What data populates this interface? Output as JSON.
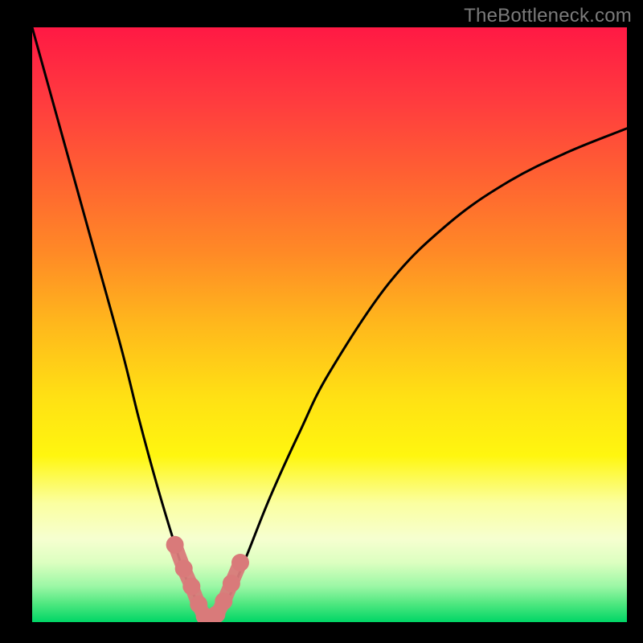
{
  "watermark": "TheBottleneck.com",
  "colors": {
    "background_black": "#000000",
    "text_gray": "#7b7b7b",
    "curve_black": "#000000",
    "accent_pink": "#d97a7a",
    "gradient_stops": [
      {
        "offset": 0.0,
        "color": "#ff1944"
      },
      {
        "offset": 0.12,
        "color": "#ff3a3f"
      },
      {
        "offset": 0.25,
        "color": "#ff6132"
      },
      {
        "offset": 0.38,
        "color": "#ff8a26"
      },
      {
        "offset": 0.5,
        "color": "#ffb81c"
      },
      {
        "offset": 0.62,
        "color": "#ffe014"
      },
      {
        "offset": 0.72,
        "color": "#fff60f"
      },
      {
        "offset": 0.8,
        "color": "#fbffa0"
      },
      {
        "offset": 0.86,
        "color": "#f6ffd0"
      },
      {
        "offset": 0.9,
        "color": "#dcffc0"
      },
      {
        "offset": 0.94,
        "color": "#9bf7a5"
      },
      {
        "offset": 0.97,
        "color": "#4de77f"
      },
      {
        "offset": 1.0,
        "color": "#00d666"
      }
    ]
  },
  "chart_data": {
    "type": "line",
    "title": "",
    "xlabel": "",
    "ylabel": "",
    "x_range": [
      0,
      100
    ],
    "y_range": [
      0,
      100
    ],
    "grid": false,
    "legend": false,
    "series": [
      {
        "name": "bottleneck-curve",
        "x": [
          0,
          5,
          10,
          15,
          18,
          21,
          24,
          26,
          28,
          29,
          30,
          31,
          33,
          36,
          40,
          45,
          50,
          60,
          70,
          80,
          90,
          100
        ],
        "y": [
          100,
          82,
          64,
          46,
          34,
          23,
          13,
          7,
          3,
          1,
          0,
          1,
          4,
          11,
          21,
          32,
          42,
          57,
          67,
          74,
          79,
          83
        ]
      }
    ],
    "highlight": {
      "name": "valley-highlight",
      "x": [
        24,
        25.5,
        26.8,
        28,
        29,
        30,
        31,
        32.2,
        33.5,
        35
      ],
      "y": [
        13,
        9,
        6,
        3,
        1,
        0.5,
        1.3,
        3.5,
        6.5,
        10
      ],
      "style": "beaded",
      "color": "#d97a7a"
    }
  }
}
